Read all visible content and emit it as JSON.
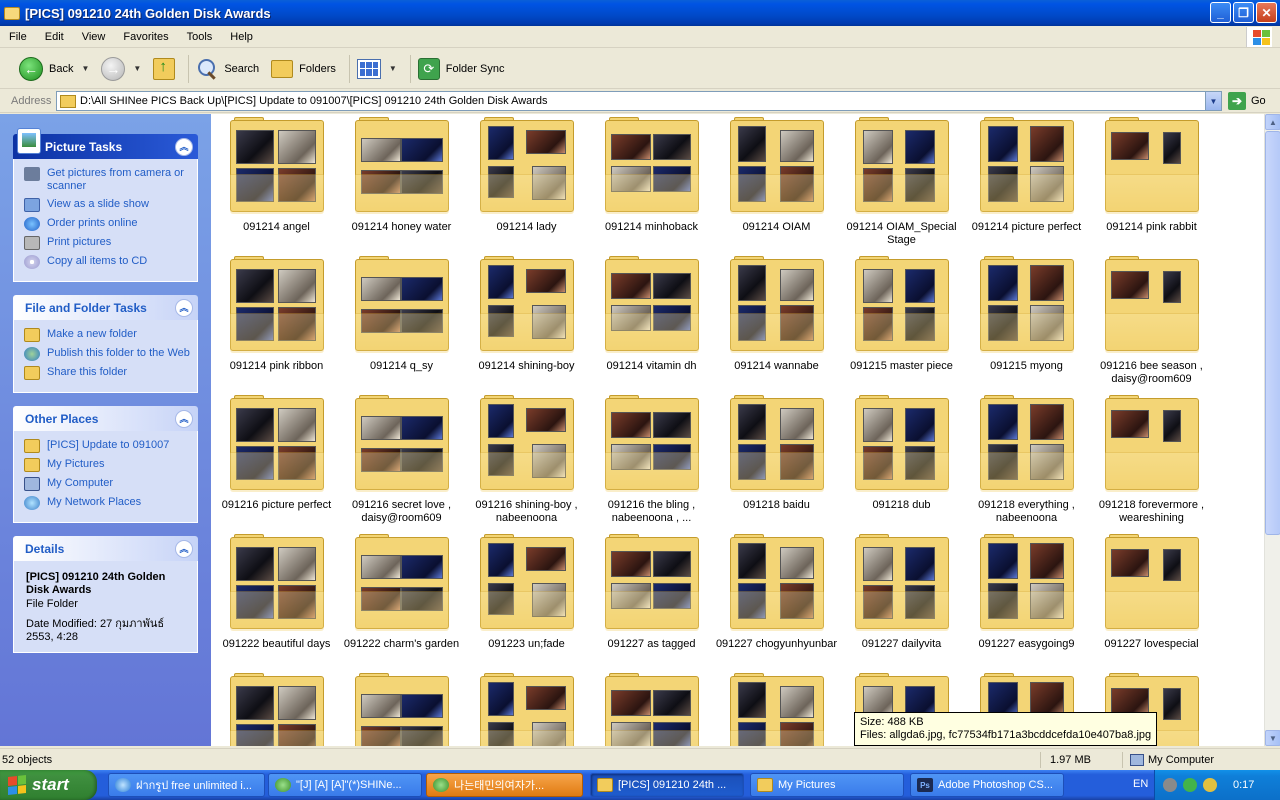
{
  "window": {
    "title": "[PICS] 091210 24th Golden Disk Awards",
    "buttons": [
      "_",
      "❐",
      "✕"
    ]
  },
  "menu": [
    "File",
    "Edit",
    "View",
    "Favorites",
    "Tools",
    "Help"
  ],
  "toolbar": {
    "back": "Back",
    "search": "Search",
    "folders": "Folders",
    "folder_sync": "Folder Sync"
  },
  "address": {
    "label": "Address",
    "path": "D:\\All SHINee PICS Back Up\\[PICS] Update to 091007\\[PICS] 091210 24th Golden Disk Awards",
    "go": "Go"
  },
  "picture_tasks": {
    "title": "Picture Tasks",
    "items": [
      {
        "label": "Get pictures from camera or scanner",
        "icon": "camera-icon"
      },
      {
        "label": "View as a slide show",
        "icon": "slideshow-icon"
      },
      {
        "label": "Order prints online",
        "icon": "order-prints-icon"
      },
      {
        "label": "Print pictures",
        "icon": "printer-icon"
      },
      {
        "label": "Copy all items to CD",
        "icon": "cd-icon"
      }
    ]
  },
  "file_tasks": {
    "title": "File and Folder Tasks",
    "items": [
      {
        "label": "Make a new folder",
        "icon": "new-folder-icon"
      },
      {
        "label": "Publish this folder to the Web",
        "icon": "publish-web-icon"
      },
      {
        "label": "Share this folder",
        "icon": "share-folder-icon"
      }
    ]
  },
  "other_places": {
    "title": "Other Places",
    "items": [
      {
        "label": "[PICS] Update to 091007",
        "icon": "folder-icon"
      },
      {
        "label": "My Pictures",
        "icon": "my-pictures-icon"
      },
      {
        "label": "My Computer",
        "icon": "my-computer-icon"
      },
      {
        "label": "My Network Places",
        "icon": "network-places-icon"
      }
    ]
  },
  "details": {
    "title": "Details",
    "name": "[PICS] 091210 24th Golden Disk Awards",
    "type": "File Folder",
    "modified": "Date Modified: 27 กุมภาพันธ์ 2553, 4:28"
  },
  "folders": [
    {
      "name": "091214 angel"
    },
    {
      "name": "091214 honey water"
    },
    {
      "name": "091214 lady"
    },
    {
      "name": "091214 minhoback"
    },
    {
      "name": "091214 OIAM"
    },
    {
      "name": "091214 OIAM_Special Stage"
    },
    {
      "name": "091214 picture perfect"
    },
    {
      "name": "091214 pink rabbit"
    },
    {
      "name": "091214 pink ribbon"
    },
    {
      "name": "091214 q_sy"
    },
    {
      "name": "091214 shining-boy"
    },
    {
      "name": "091214 vitamin dh"
    },
    {
      "name": "091214 wannabe"
    },
    {
      "name": "091215 master piece"
    },
    {
      "name": "091215 myong"
    },
    {
      "name": "091216 bee season , daisy@room609"
    },
    {
      "name": "091216 picture perfect"
    },
    {
      "name": "091216 secret love , daisy@room609"
    },
    {
      "name": "091216 shining-boy , nabeenoona"
    },
    {
      "name": "091216 the bling , nabeenoona , ..."
    },
    {
      "name": "091218 baidu"
    },
    {
      "name": "091218 dub"
    },
    {
      "name": "091218 everything , nabeenoona"
    },
    {
      "name": "091218 forevermore , weareshining"
    },
    {
      "name": "091222 beautiful days"
    },
    {
      "name": "091222 charm's garden"
    },
    {
      "name": "091223 un;fade"
    },
    {
      "name": "091227 as tagged"
    },
    {
      "name": "091227 chogyunhyunbar"
    },
    {
      "name": "091227 dailyvita"
    },
    {
      "name": "091227 easygoing9"
    },
    {
      "name": "091227 lovespecial"
    },
    {
      "name": ""
    },
    {
      "name": ""
    },
    {
      "name": ""
    },
    {
      "name": ""
    },
    {
      "name": ""
    },
    {
      "name": ""
    },
    {
      "name": ""
    },
    {
      "name": ""
    }
  ],
  "tooltip": {
    "size": "Size: 488 KB",
    "files": "Files: allgda6.jpg, fc77534fb171a3bcddcefda10e407ba8.jpg"
  },
  "status": {
    "objects": "52 objects",
    "size": "1.97 MB",
    "location": "My Computer"
  },
  "taskbar": {
    "start": "start",
    "buttons": [
      {
        "label": "ฝากรูป free unlimited i...",
        "icon": "ie-icon"
      },
      {
        "label": "\"[J] [A] [A]\"(*)SHINe...",
        "icon": "messenger-icon"
      },
      {
        "label": "나는태민의여자가...",
        "icon": "messenger-icon"
      },
      {
        "label": "[PICS] 091210 24th ...",
        "icon": "folder-icon"
      },
      {
        "label": "My Pictures",
        "icon": "folder-icon"
      },
      {
        "label": "Adobe Photoshop CS...",
        "icon": "photoshop-icon"
      }
    ],
    "lang": "EN",
    "clock": "0:17"
  }
}
